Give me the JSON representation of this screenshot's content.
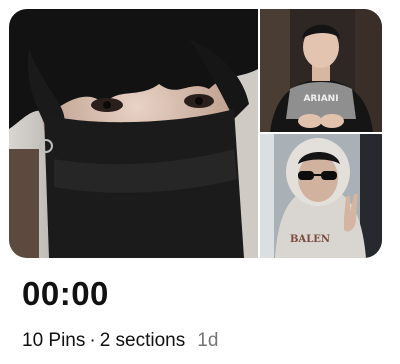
{
  "board": {
    "title": "00:00",
    "pin_count": "10 Pins",
    "separator": "·",
    "section_count": "2 sections",
    "age": "1d"
  },
  "cover": {
    "images": [
      {
        "name": "cover-image-main",
        "subject": "person-face-mask-photo"
      },
      {
        "name": "cover-image-top-right",
        "subject": "person-black-tshirt-photo"
      },
      {
        "name": "cover-image-bottom-right",
        "subject": "person-hood-sunglasses-photo"
      }
    ]
  },
  "colors": {
    "title_text": "#111111",
    "secondary_text": "#767676",
    "background": "#ffffff"
  }
}
